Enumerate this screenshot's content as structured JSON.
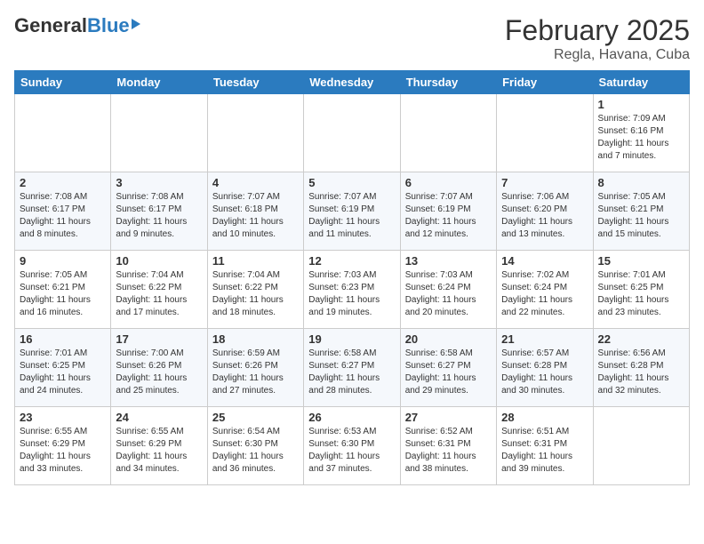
{
  "header": {
    "logo_general": "General",
    "logo_blue": "Blue",
    "month_title": "February 2025",
    "location": "Regla, Havana, Cuba"
  },
  "weekdays": [
    "Sunday",
    "Monday",
    "Tuesday",
    "Wednesday",
    "Thursday",
    "Friday",
    "Saturday"
  ],
  "weeks": [
    [
      {
        "day": "",
        "info": ""
      },
      {
        "day": "",
        "info": ""
      },
      {
        "day": "",
        "info": ""
      },
      {
        "day": "",
        "info": ""
      },
      {
        "day": "",
        "info": ""
      },
      {
        "day": "",
        "info": ""
      },
      {
        "day": "1",
        "info": "Sunrise: 7:09 AM\nSunset: 6:16 PM\nDaylight: 11 hours and 7 minutes."
      }
    ],
    [
      {
        "day": "2",
        "info": "Sunrise: 7:08 AM\nSunset: 6:17 PM\nDaylight: 11 hours and 8 minutes."
      },
      {
        "day": "3",
        "info": "Sunrise: 7:08 AM\nSunset: 6:17 PM\nDaylight: 11 hours and 9 minutes."
      },
      {
        "day": "4",
        "info": "Sunrise: 7:07 AM\nSunset: 6:18 PM\nDaylight: 11 hours and 10 minutes."
      },
      {
        "day": "5",
        "info": "Sunrise: 7:07 AM\nSunset: 6:19 PM\nDaylight: 11 hours and 11 minutes."
      },
      {
        "day": "6",
        "info": "Sunrise: 7:07 AM\nSunset: 6:19 PM\nDaylight: 11 hours and 12 minutes."
      },
      {
        "day": "7",
        "info": "Sunrise: 7:06 AM\nSunset: 6:20 PM\nDaylight: 11 hours and 13 minutes."
      },
      {
        "day": "8",
        "info": "Sunrise: 7:05 AM\nSunset: 6:21 PM\nDaylight: 11 hours and 15 minutes."
      }
    ],
    [
      {
        "day": "9",
        "info": "Sunrise: 7:05 AM\nSunset: 6:21 PM\nDaylight: 11 hours and 16 minutes."
      },
      {
        "day": "10",
        "info": "Sunrise: 7:04 AM\nSunset: 6:22 PM\nDaylight: 11 hours and 17 minutes."
      },
      {
        "day": "11",
        "info": "Sunrise: 7:04 AM\nSunset: 6:22 PM\nDaylight: 11 hours and 18 minutes."
      },
      {
        "day": "12",
        "info": "Sunrise: 7:03 AM\nSunset: 6:23 PM\nDaylight: 11 hours and 19 minutes."
      },
      {
        "day": "13",
        "info": "Sunrise: 7:03 AM\nSunset: 6:24 PM\nDaylight: 11 hours and 20 minutes."
      },
      {
        "day": "14",
        "info": "Sunrise: 7:02 AM\nSunset: 6:24 PM\nDaylight: 11 hours and 22 minutes."
      },
      {
        "day": "15",
        "info": "Sunrise: 7:01 AM\nSunset: 6:25 PM\nDaylight: 11 hours and 23 minutes."
      }
    ],
    [
      {
        "day": "16",
        "info": "Sunrise: 7:01 AM\nSunset: 6:25 PM\nDaylight: 11 hours and 24 minutes."
      },
      {
        "day": "17",
        "info": "Sunrise: 7:00 AM\nSunset: 6:26 PM\nDaylight: 11 hours and 25 minutes."
      },
      {
        "day": "18",
        "info": "Sunrise: 6:59 AM\nSunset: 6:26 PM\nDaylight: 11 hours and 27 minutes."
      },
      {
        "day": "19",
        "info": "Sunrise: 6:58 AM\nSunset: 6:27 PM\nDaylight: 11 hours and 28 minutes."
      },
      {
        "day": "20",
        "info": "Sunrise: 6:58 AM\nSunset: 6:27 PM\nDaylight: 11 hours and 29 minutes."
      },
      {
        "day": "21",
        "info": "Sunrise: 6:57 AM\nSunset: 6:28 PM\nDaylight: 11 hours and 30 minutes."
      },
      {
        "day": "22",
        "info": "Sunrise: 6:56 AM\nSunset: 6:28 PM\nDaylight: 11 hours and 32 minutes."
      }
    ],
    [
      {
        "day": "23",
        "info": "Sunrise: 6:55 AM\nSunset: 6:29 PM\nDaylight: 11 hours and 33 minutes."
      },
      {
        "day": "24",
        "info": "Sunrise: 6:55 AM\nSunset: 6:29 PM\nDaylight: 11 hours and 34 minutes."
      },
      {
        "day": "25",
        "info": "Sunrise: 6:54 AM\nSunset: 6:30 PM\nDaylight: 11 hours and 36 minutes."
      },
      {
        "day": "26",
        "info": "Sunrise: 6:53 AM\nSunset: 6:30 PM\nDaylight: 11 hours and 37 minutes."
      },
      {
        "day": "27",
        "info": "Sunrise: 6:52 AM\nSunset: 6:31 PM\nDaylight: 11 hours and 38 minutes."
      },
      {
        "day": "28",
        "info": "Sunrise: 6:51 AM\nSunset: 6:31 PM\nDaylight: 11 hours and 39 minutes."
      },
      {
        "day": "",
        "info": ""
      }
    ]
  ]
}
